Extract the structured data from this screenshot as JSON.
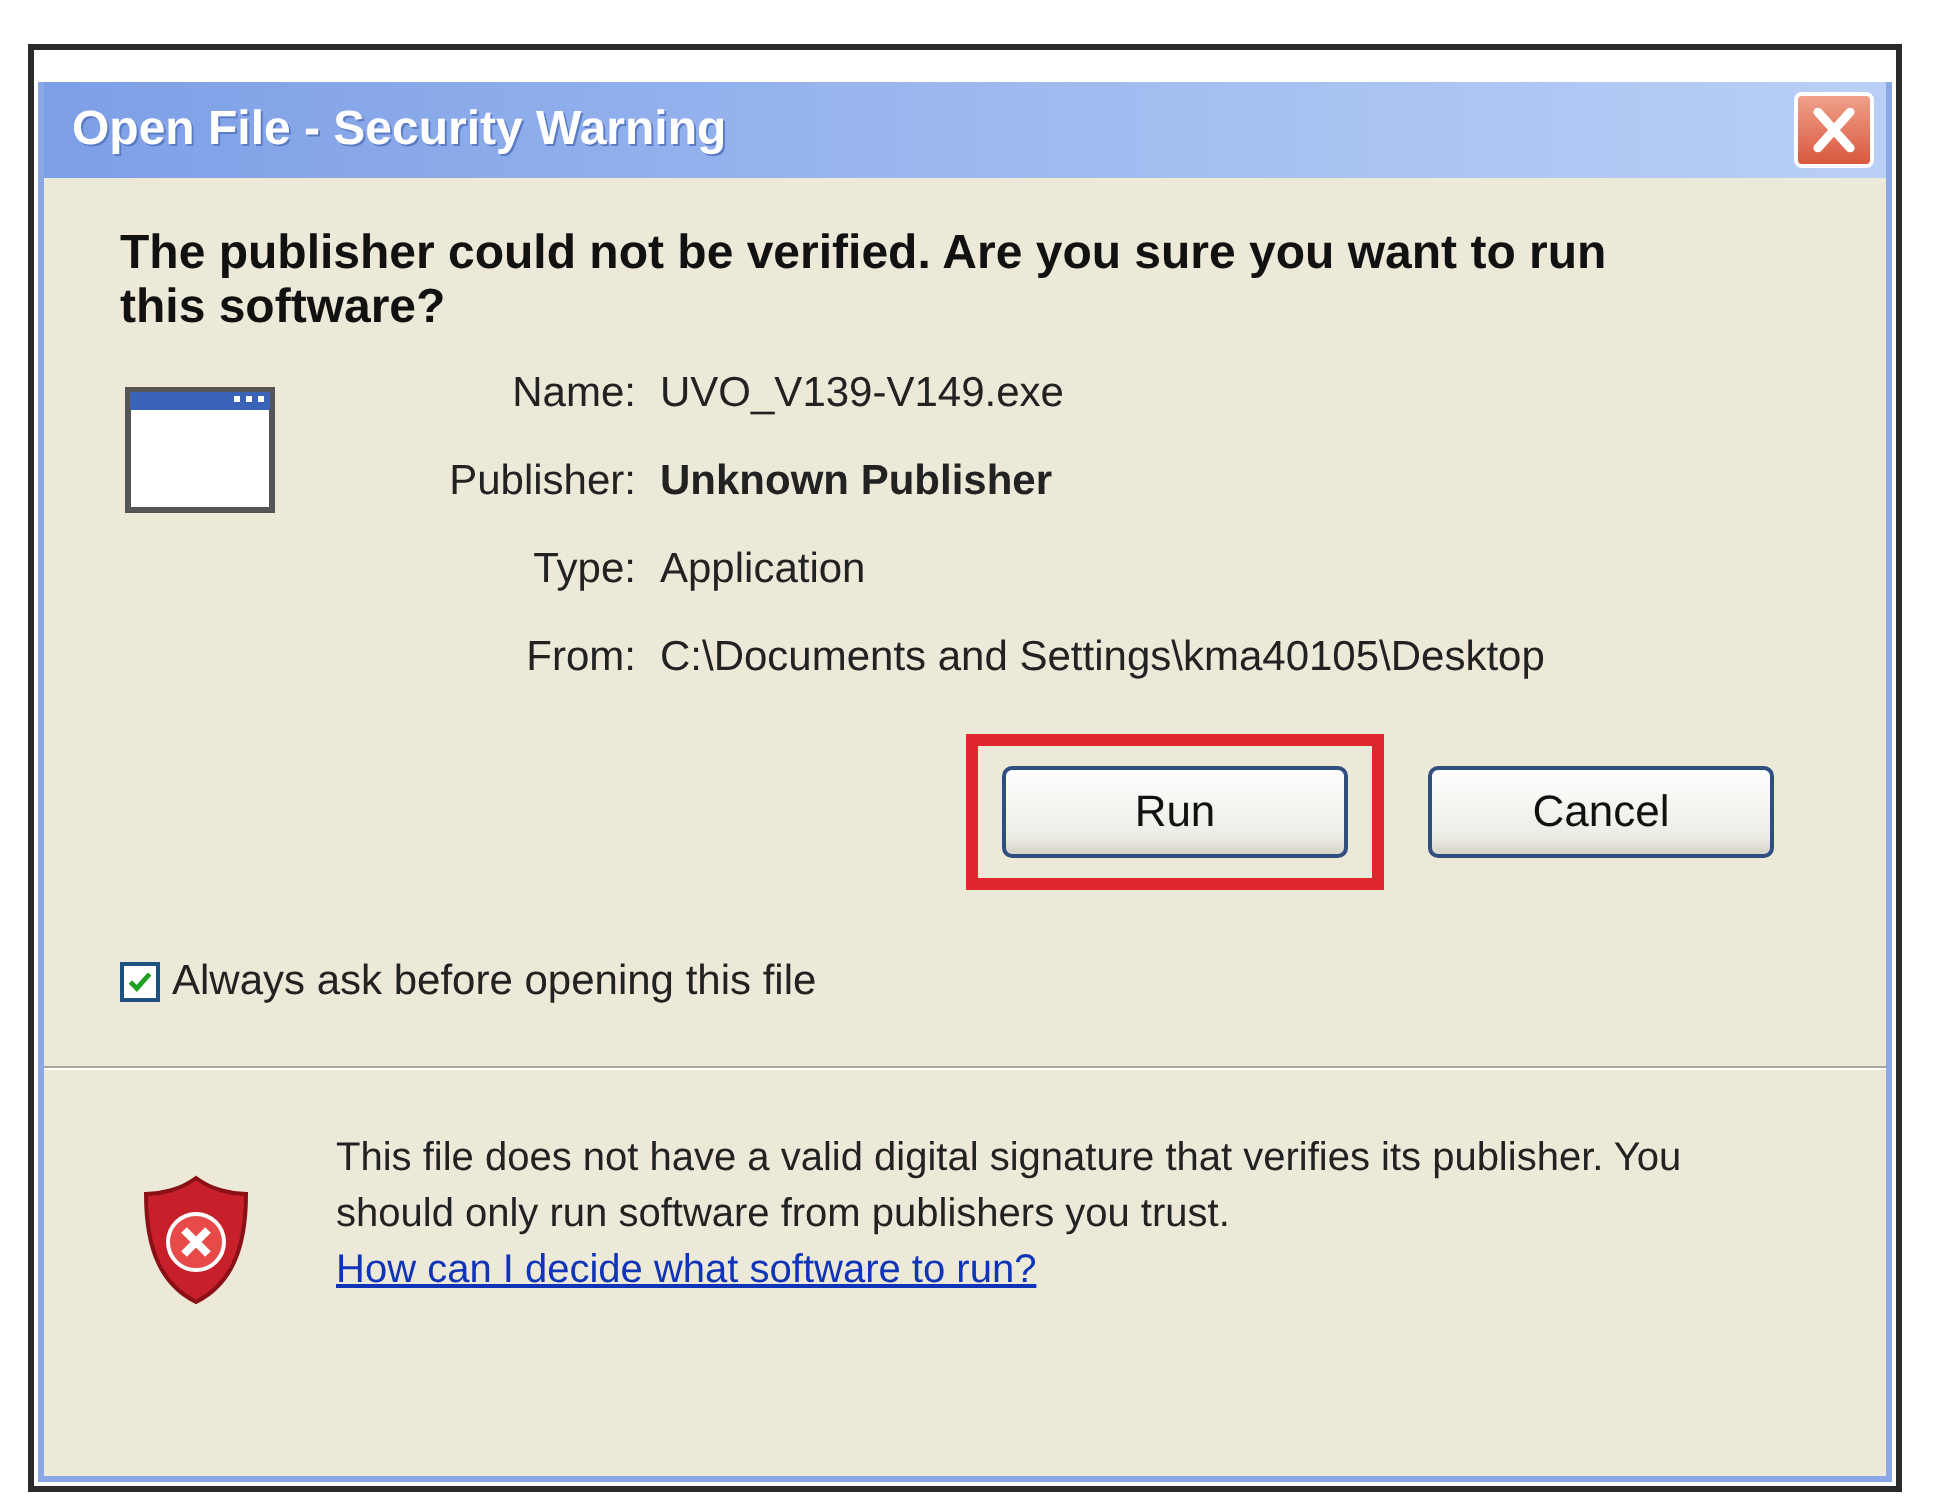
{
  "window": {
    "title": "Open File - Security Warning"
  },
  "heading": "The publisher could not be verified.  Are you sure you want to run this software?",
  "fields": [
    {
      "label": "Name:",
      "value": "UVO_V139-V149.exe",
      "kind": "plain"
    },
    {
      "label": "Publisher:",
      "value": "Unknown Publisher",
      "kind": "bold"
    },
    {
      "label": "Type:",
      "value": "Application",
      "kind": "plain"
    },
    {
      "label": "From:",
      "value": "C:\\Documents and Settings\\kma40105\\Desktop",
      "kind": "plain"
    }
  ],
  "buttons": [
    {
      "label": "Run",
      "highlighted": true
    },
    {
      "label": "Cancel",
      "highlighted": false
    }
  ],
  "checkbox": {
    "label": "Always ask before opening this file",
    "checked": true
  },
  "warning": {
    "text": "This file does not have a valid digital signature that verifies its publisher.  You should only run software from publishers you trust.",
    "link": "How can I decide what software to run?"
  }
}
